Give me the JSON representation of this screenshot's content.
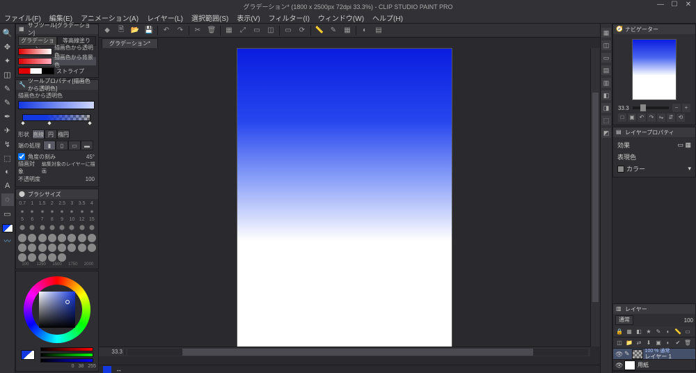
{
  "app": {
    "title": "グラデーション* (1800 x 2500px 72dpi 33.3%)  -  CLIP STUDIO PAINT PRO",
    "win": {
      "min": "—",
      "max": "☐",
      "close": "✕"
    }
  },
  "menu": [
    "ファイル(F)",
    "編集(E)",
    "アニメーション(A)",
    "レイヤー(L)",
    "選択範囲(S)",
    "表示(V)",
    "フィルター(I)",
    "ウィンドウ(W)",
    "ヘルプ(H)"
  ],
  "toolbox": {
    "tools": [
      "🔍",
      "✥",
      "✦",
      "◫",
      "✎",
      "✎",
      "✒",
      "✈",
      "↯",
      "⬚",
      "◐",
      "A",
      "◌",
      "▭"
    ],
    "selected_index": 12
  },
  "subtool": {
    "title": "サブツール[グラデーション]",
    "tabs": [
      "グラデーション",
      "等高線塗り"
    ],
    "active_tab": 0,
    "presets": [
      {
        "label": "描画色から透明色"
      },
      {
        "label": "描画色から背景色"
      },
      {
        "label": "ストライプ"
      }
    ],
    "selected_preset": 1
  },
  "toolprop": {
    "title": "ツールプロパティ[描画色から透明色]",
    "name_label": "描画色から透明色",
    "shape_label": "形状",
    "shape_opts": [
      "直線",
      "円",
      "楕円"
    ],
    "shape_sel": 0,
    "edge_label": "端の処理",
    "angle_label": "角度の刻み",
    "angle_val": "45°",
    "target_label": "描画対象",
    "target_val": "編集対象のレイヤーに描画",
    "opacity_label": "不透明度",
    "opacity_val": "100"
  },
  "brushsize": {
    "title": "ブラシサイズ",
    "row1": [
      "0.7",
      "1",
      "1.5",
      "2",
      "2.5",
      "3",
      "3.5",
      "4"
    ],
    "row2": [
      "5",
      "6",
      "7",
      "8",
      "9",
      "10",
      "12",
      "15"
    ],
    "row4_labels": [
      "100",
      "1250",
      "1500",
      "1750",
      "2000"
    ]
  },
  "colorwheel": {
    "rgb": {
      "r": "0",
      "g": "38",
      "b": "255"
    }
  },
  "canvas": {
    "doc_tab": "グラデーション*",
    "zoom": "33.3"
  },
  "navigator": {
    "title": "ナビゲーター",
    "zoom": "33.3"
  },
  "layerprop": {
    "title": "レイヤープロパティ",
    "effect_label": "効果",
    "expr_label": "表現色",
    "expr_val": "カラー"
  },
  "layers": {
    "title": "レイヤー",
    "blend": "通常",
    "opacity": "100",
    "items": [
      {
        "name": "レイヤー 1",
        "sub": "100 % 通常",
        "thumb": "chk"
      },
      {
        "name": "用紙",
        "sub": "",
        "thumb": "white"
      }
    ],
    "selected": 0
  }
}
